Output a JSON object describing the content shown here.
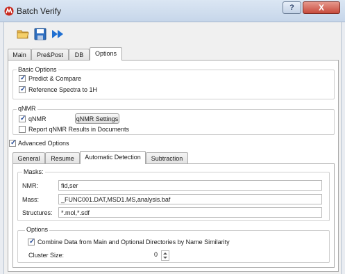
{
  "window": {
    "title": "Batch Verify",
    "help_label": "?",
    "close_label": "X"
  },
  "main_tabs": [
    "Main",
    "Pre&Post",
    "DB",
    "Options"
  ],
  "basic_options": {
    "title": "Basic Options",
    "predict_compare": "Predict & Compare",
    "reference_spectra": "Reference Spectra to 1H"
  },
  "qnmr": {
    "title": "qNMR",
    "qnmr_label": "qNMR",
    "settings_button": "qNMR Settings",
    "report_label": "Report qNMR Results in Documents"
  },
  "advanced": {
    "label": "Advanced Options"
  },
  "sub_tabs": [
    "General",
    "Resume",
    "Automatic Detection",
    "Subtraction"
  ],
  "masks": {
    "title": "Masks:",
    "nmr_label": "NMR:",
    "nmr_value": "fid,ser",
    "mass_label": "Mass:",
    "mass_value": "_FUNC001.DAT,MSD1.MS,analysis.baf",
    "structures_label": "Structures:",
    "structures_value": "*.mol,*.sdf"
  },
  "options": {
    "title": "Options",
    "combine_label": "Combine Data from Main and Optional Directories by Name Similarity",
    "cluster_label": "Cluster Size:",
    "cluster_value": "0"
  },
  "colors": {
    "accent": "#2a4f9a",
    "title_bar": "#c6d6ea",
    "close": "#c74b3d"
  }
}
